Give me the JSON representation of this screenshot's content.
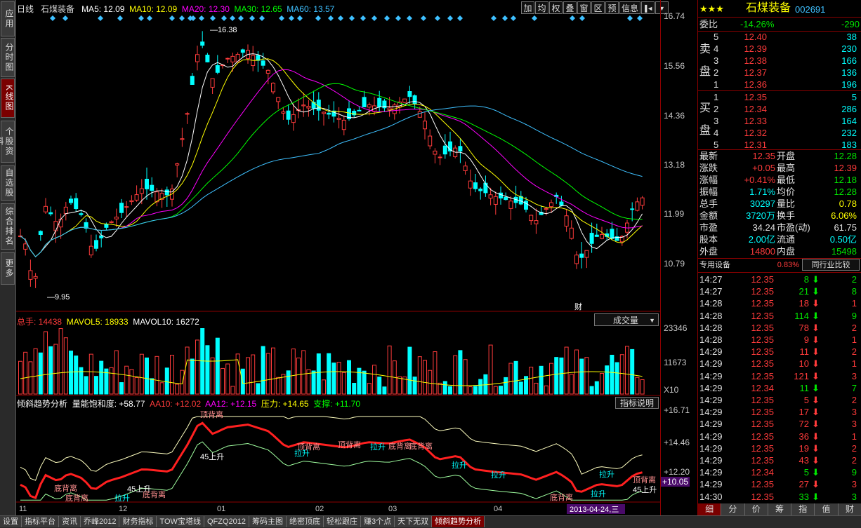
{
  "left_tabs": [
    {
      "label": "应用",
      "active": false
    },
    {
      "label": "分时图",
      "active": false
    },
    {
      "label": "K线图",
      "active": true
    },
    {
      "label": "个股资料",
      "active": false
    },
    {
      "label": "自选股",
      "active": false
    },
    {
      "label": "综合排名",
      "active": false
    },
    {
      "label": "更多",
      "active": false
    }
  ],
  "header": {
    "period": "日线",
    "stock_name": "石煤装备",
    "ma5": "MA5: 12.09",
    "ma10": "MA10: 12.09",
    "ma20": "MA20: 12.30",
    "ma30": "MA30: 12.65",
    "ma60": "MA60: 13.57"
  },
  "toolbar": [
    "加",
    "均",
    "权",
    "叠",
    "窗",
    "区",
    "预",
    "信息"
  ],
  "price_axis": [
    "16.74",
    "15.56",
    "14.36",
    "13.18",
    "11.99",
    "10.79"
  ],
  "price_annotations": {
    "high": "16.38",
    "low": "9.95",
    "marker": "财"
  },
  "volume_panel": {
    "zongshou": "总手: 14438",
    "mavol5": "MAVOL5: 18933",
    "mavol10": "MAVOL10: 16272",
    "selector": "成交量",
    "axis": [
      "23346",
      "11673"
    ],
    "unit": "X10"
  },
  "indicator_panel": {
    "name": "倾斜趋势分析",
    "saturation": "量能饱和度: +58.77",
    "aa10": "AA10: +12.02",
    "aa12": "AA12: +12.15",
    "pressure": "压力: +14.65",
    "support": "支撑: +11.70",
    "help_button": "指标说明",
    "axis": [
      "+16.71",
      "+14.46",
      "+12.20",
      "+10.05"
    ],
    "labels": [
      "顶背离",
      "45上升",
      "底背离",
      "底背离",
      "顶背离",
      "拉升",
      "顶背离",
      "拉升",
      "底背离",
      "底背离",
      "拉升",
      "拉升",
      "底背离",
      "45上升",
      "拉升",
      "底背离",
      "拉升",
      "顶背离",
      "45上升",
      "拉升"
    ]
  },
  "date_axis": [
    "11",
    "12",
    "01",
    "02",
    "03",
    "04"
  ],
  "date_cursor": "2013-04-24,三",
  "bottom_tabs": [
    "设置",
    "指标平台",
    "资讯",
    "乔峰2012",
    "财务指标",
    "TOW宝塔线",
    "QFZQ2012",
    "筹码主图",
    "绝密顶底",
    "轻松跟庄",
    "赚3个点",
    "天下无双",
    "倾斜趋势分析"
  ],
  "bottom_right_tabs": [
    "细",
    "分",
    "价",
    "筹",
    "指",
    "值",
    "财"
  ],
  "quote": {
    "stock_title": "石煤装备",
    "code": "002691",
    "weibi_label": "委比",
    "weibi_value": "-14.26%",
    "weibi_diff": "-290",
    "sell_label": [
      "卖",
      "盘"
    ],
    "buy_label": [
      "买",
      "盘"
    ],
    "asks": [
      {
        "level": "5",
        "price": "12.40",
        "vol": "38"
      },
      {
        "level": "4",
        "price": "12.39",
        "vol": "230"
      },
      {
        "level": "3",
        "price": "12.38",
        "vol": "166"
      },
      {
        "level": "2",
        "price": "12.37",
        "vol": "136"
      },
      {
        "level": "1",
        "price": "12.36",
        "vol": "196"
      }
    ],
    "bids": [
      {
        "level": "1",
        "price": "12.35",
        "vol": "5"
      },
      {
        "level": "2",
        "price": "12.34",
        "vol": "286"
      },
      {
        "level": "3",
        "price": "12.33",
        "vol": "164"
      },
      {
        "level": "4",
        "price": "12.32",
        "vol": "232"
      },
      {
        "level": "5",
        "price": "12.31",
        "vol": "183"
      }
    ],
    "stats": [
      {
        "l1": "最新",
        "v1": "12.35",
        "c1": "red",
        "l2": "开盘",
        "v2": "12.28",
        "c2": "green"
      },
      {
        "l1": "涨跌",
        "v1": "+0.05",
        "c1": "red",
        "l2": "最高",
        "v2": "12.39",
        "c2": "red"
      },
      {
        "l1": "涨幅",
        "v1": "+0.41%",
        "c1": "red",
        "l2": "最低",
        "v2": "12.18",
        "c2": "green"
      },
      {
        "l1": "振幅",
        "v1": "1.71%",
        "c1": "cyan",
        "l2": "均价",
        "v2": "12.28",
        "c2": "green"
      },
      {
        "l1": "总手",
        "v1": "30297",
        "c1": "cyan",
        "l2": "量比",
        "v2": "0.78",
        "c2": "yellow"
      },
      {
        "l1": "金额",
        "v1": "3720万",
        "c1": "cyan",
        "l2": "换手",
        "v2": "6.06%",
        "c2": "yellow"
      },
      {
        "l1": "市盈",
        "v1": "34.24",
        "c1": "white",
        "l2": "市盈(动)",
        "v2": "61.75",
        "c2": "white"
      },
      {
        "l1": "股本",
        "v1": "2.00亿",
        "c1": "cyan",
        "l2": "流通",
        "v2": "0.50亿",
        "c2": "cyan"
      },
      {
        "l1": "外盘",
        "v1": "14800",
        "c1": "red",
        "l2": "内盘",
        "v2": "15498",
        "c2": "green"
      }
    ],
    "industry": "专用设备",
    "industry_pct": "0.83%",
    "industry_button": "同行业比较",
    "ticks": [
      {
        "time": "14:27",
        "price": "12.35",
        "vol": "8",
        "dir": "down"
      },
      {
        "time": "14:27",
        "price": "12.35",
        "vol": "21",
        "dir": "down"
      },
      {
        "time": "14:28",
        "price": "12.35",
        "vol": "18",
        "dir": "up"
      },
      {
        "time": "14:28",
        "price": "12.35",
        "vol": "114",
        "dir": "down"
      },
      {
        "time": "14:28",
        "price": "12.35",
        "vol": "78",
        "dir": "up"
      },
      {
        "time": "14:28",
        "price": "12.35",
        "vol": "9",
        "dir": "up"
      },
      {
        "time": "14:29",
        "price": "12.35",
        "vol": "11",
        "dir": "up"
      },
      {
        "time": "14:29",
        "price": "12.35",
        "vol": "10",
        "dir": "up"
      },
      {
        "time": "14:29",
        "price": "12.35",
        "vol": "121",
        "dir": "up"
      },
      {
        "time": "14:29",
        "price": "12.34",
        "vol": "11",
        "dir": "down"
      },
      {
        "time": "14:29",
        "price": "12.35",
        "vol": "5",
        "dir": "up"
      },
      {
        "time": "14:29",
        "price": "12.35",
        "vol": "17",
        "dir": "up"
      },
      {
        "time": "14:29",
        "price": "12.35",
        "vol": "72",
        "dir": "up"
      },
      {
        "time": "14:29",
        "price": "12.35",
        "vol": "36",
        "dir": "up"
      },
      {
        "time": "14:29",
        "price": "12.35",
        "vol": "19",
        "dir": "up"
      },
      {
        "time": "14:29",
        "price": "12.35",
        "vol": "43",
        "dir": "up"
      },
      {
        "time": "14:29",
        "price": "12.34",
        "vol": "5",
        "dir": "down"
      },
      {
        "time": "14:29",
        "price": "12.35",
        "vol": "27",
        "dir": "up"
      },
      {
        "time": "14:30",
        "price": "12.35",
        "vol": "33",
        "dir": "down"
      }
    ],
    "tick_tail": [
      "2",
      "8",
      "1",
      "9",
      "2",
      "1",
      "2",
      "1",
      "3",
      "7",
      "2",
      "3",
      "3",
      "1",
      "2",
      "2",
      "9",
      "3",
      "3"
    ]
  },
  "colors": {
    "up": "#ff3b3b",
    "down": "#00ffff",
    "ma5": "#ffffff",
    "ma10": "#ffff00",
    "ma20": "#ff00ff",
    "ma30": "#00ff00",
    "ma60": "#3ec0ff",
    "frame": "#8b0000"
  }
}
